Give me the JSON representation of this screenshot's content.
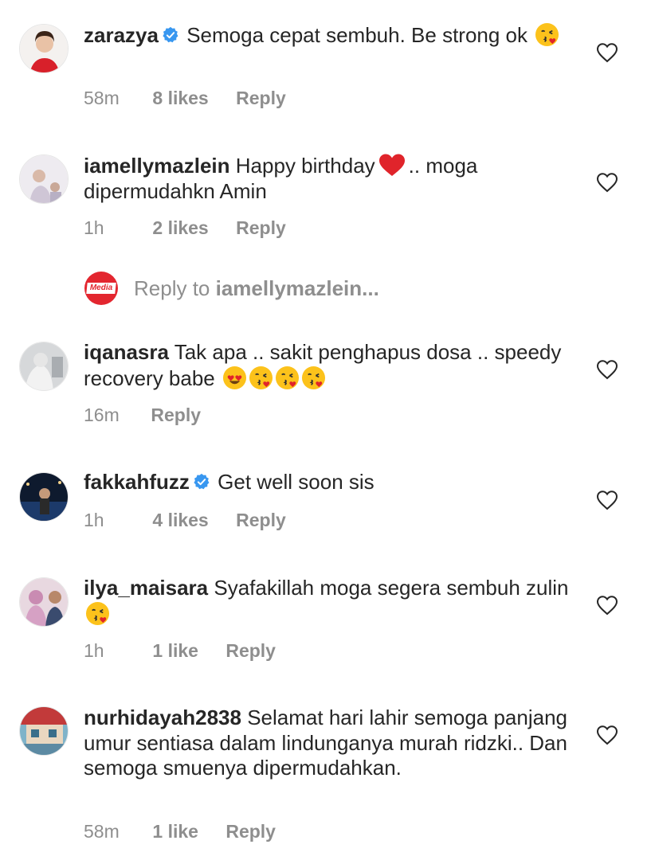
{
  "comments": [
    {
      "username": "zarazya",
      "verified": true,
      "text": "Semoga cepat sembuh. Be strong ok",
      "emojis": [
        "kissing-heart"
      ],
      "time": "58m",
      "likes": "8 likes",
      "reply": "Reply"
    },
    {
      "username": "iamellymazlein",
      "verified": false,
      "text_before": "Happy birthday",
      "text_after": ".. moga dipermudahkn Amin",
      "time": "1h",
      "likes": "2 likes",
      "reply": "Reply"
    },
    {
      "username": "iqanasra",
      "verified": false,
      "text": "Tak apa .. sakit penghapus dosa .. speedy recovery babe",
      "emojis": [
        "heart-eyes",
        "kissing-heart",
        "kissing-heart",
        "kissing-heart"
      ],
      "time": "16m",
      "likes": "",
      "reply": "Reply"
    },
    {
      "username": "fakkahfuzz",
      "verified": true,
      "text": "Get well soon sis",
      "time": "1h",
      "likes": "4 likes",
      "reply": "Reply"
    },
    {
      "username": "ilya_maisara",
      "verified": false,
      "text": "Syafakillah moga segera sembuh zulin",
      "emojis": [
        "kissing-heart"
      ],
      "time": "1h",
      "likes": "1 like",
      "reply": "Reply"
    },
    {
      "username": "nurhidayah2838",
      "verified": false,
      "text": "Selamat hari lahir semoga panjang umur sentiasa dalam lindunganya murah ridzki.. Dan semoga smuenya dipermudahkan.",
      "time": "58m",
      "likes": "1 like",
      "reply": "Reply"
    }
  ],
  "reply_prompt": {
    "prefix": "Reply to",
    "target": "iamellymazlein...",
    "logo_text": "Media"
  },
  "colors": {
    "text": "#262626",
    "secondary": "#8e8e8e",
    "verified": "#3897f0",
    "logo": "#e3262f",
    "heart_emoji": "#e0242b"
  },
  "icons": {
    "verified": "verified-badge-icon",
    "like": "heart-outline-icon"
  }
}
